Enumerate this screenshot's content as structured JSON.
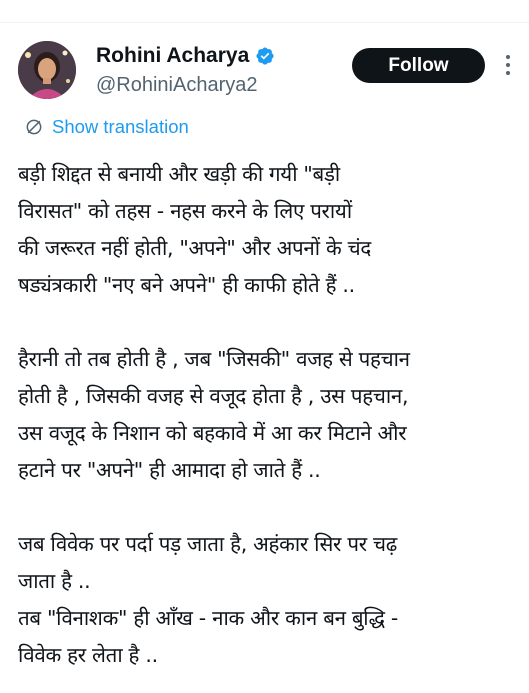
{
  "author": {
    "display_name": "Rohini Acharya",
    "handle": "@RohiniAcharya2",
    "verified_icon": "verified-badge-icon",
    "avatar_icon": "profile-photo"
  },
  "actions": {
    "follow_label": "Follow",
    "more_icon": "more-vertical-icon"
  },
  "translation": {
    "label": "Show translation",
    "icon": "translate-icon"
  },
  "colors": {
    "accent": "#1d9bf0",
    "text_primary": "#0f1419",
    "text_secondary": "#536471",
    "button_bg": "#0f1419",
    "button_text": "#ffffff"
  },
  "tweet": {
    "lines": [
      "बड़ी शिद्दत से बनायी और खड़ी की गयी \"बड़ी",
      "विरासत\" को तहस - नहस करने के लिए परायों",
      "की जरूरत नहीं होती, \"अपने\" और अपनों के चंद",
      "षड्यंत्रकारी \"नए बने अपने\" ही काफी होते हैं ..",
      "",
      "हैरानी तो तब होती है , जब \"जिसकी\" वजह से पहचान",
      "होती है , जिसकी वजह से वजूद होता है , उस पहचान,",
      "उस वजूद के निशान को बहकावे में आ कर मिटाने और",
      "हटाने पर \"अपने\" ही आमादा हो जाते हैं ..",
      "",
      "जब विवेक पर पर्दा पड़ जाता है, अहंकार सिर पर चढ़",
      "जाता है ..",
      "तब \"विनाशक\" ही आँख - नाक और कान बन बुद्धि -",
      "विवेक हर लेता है .."
    ]
  }
}
